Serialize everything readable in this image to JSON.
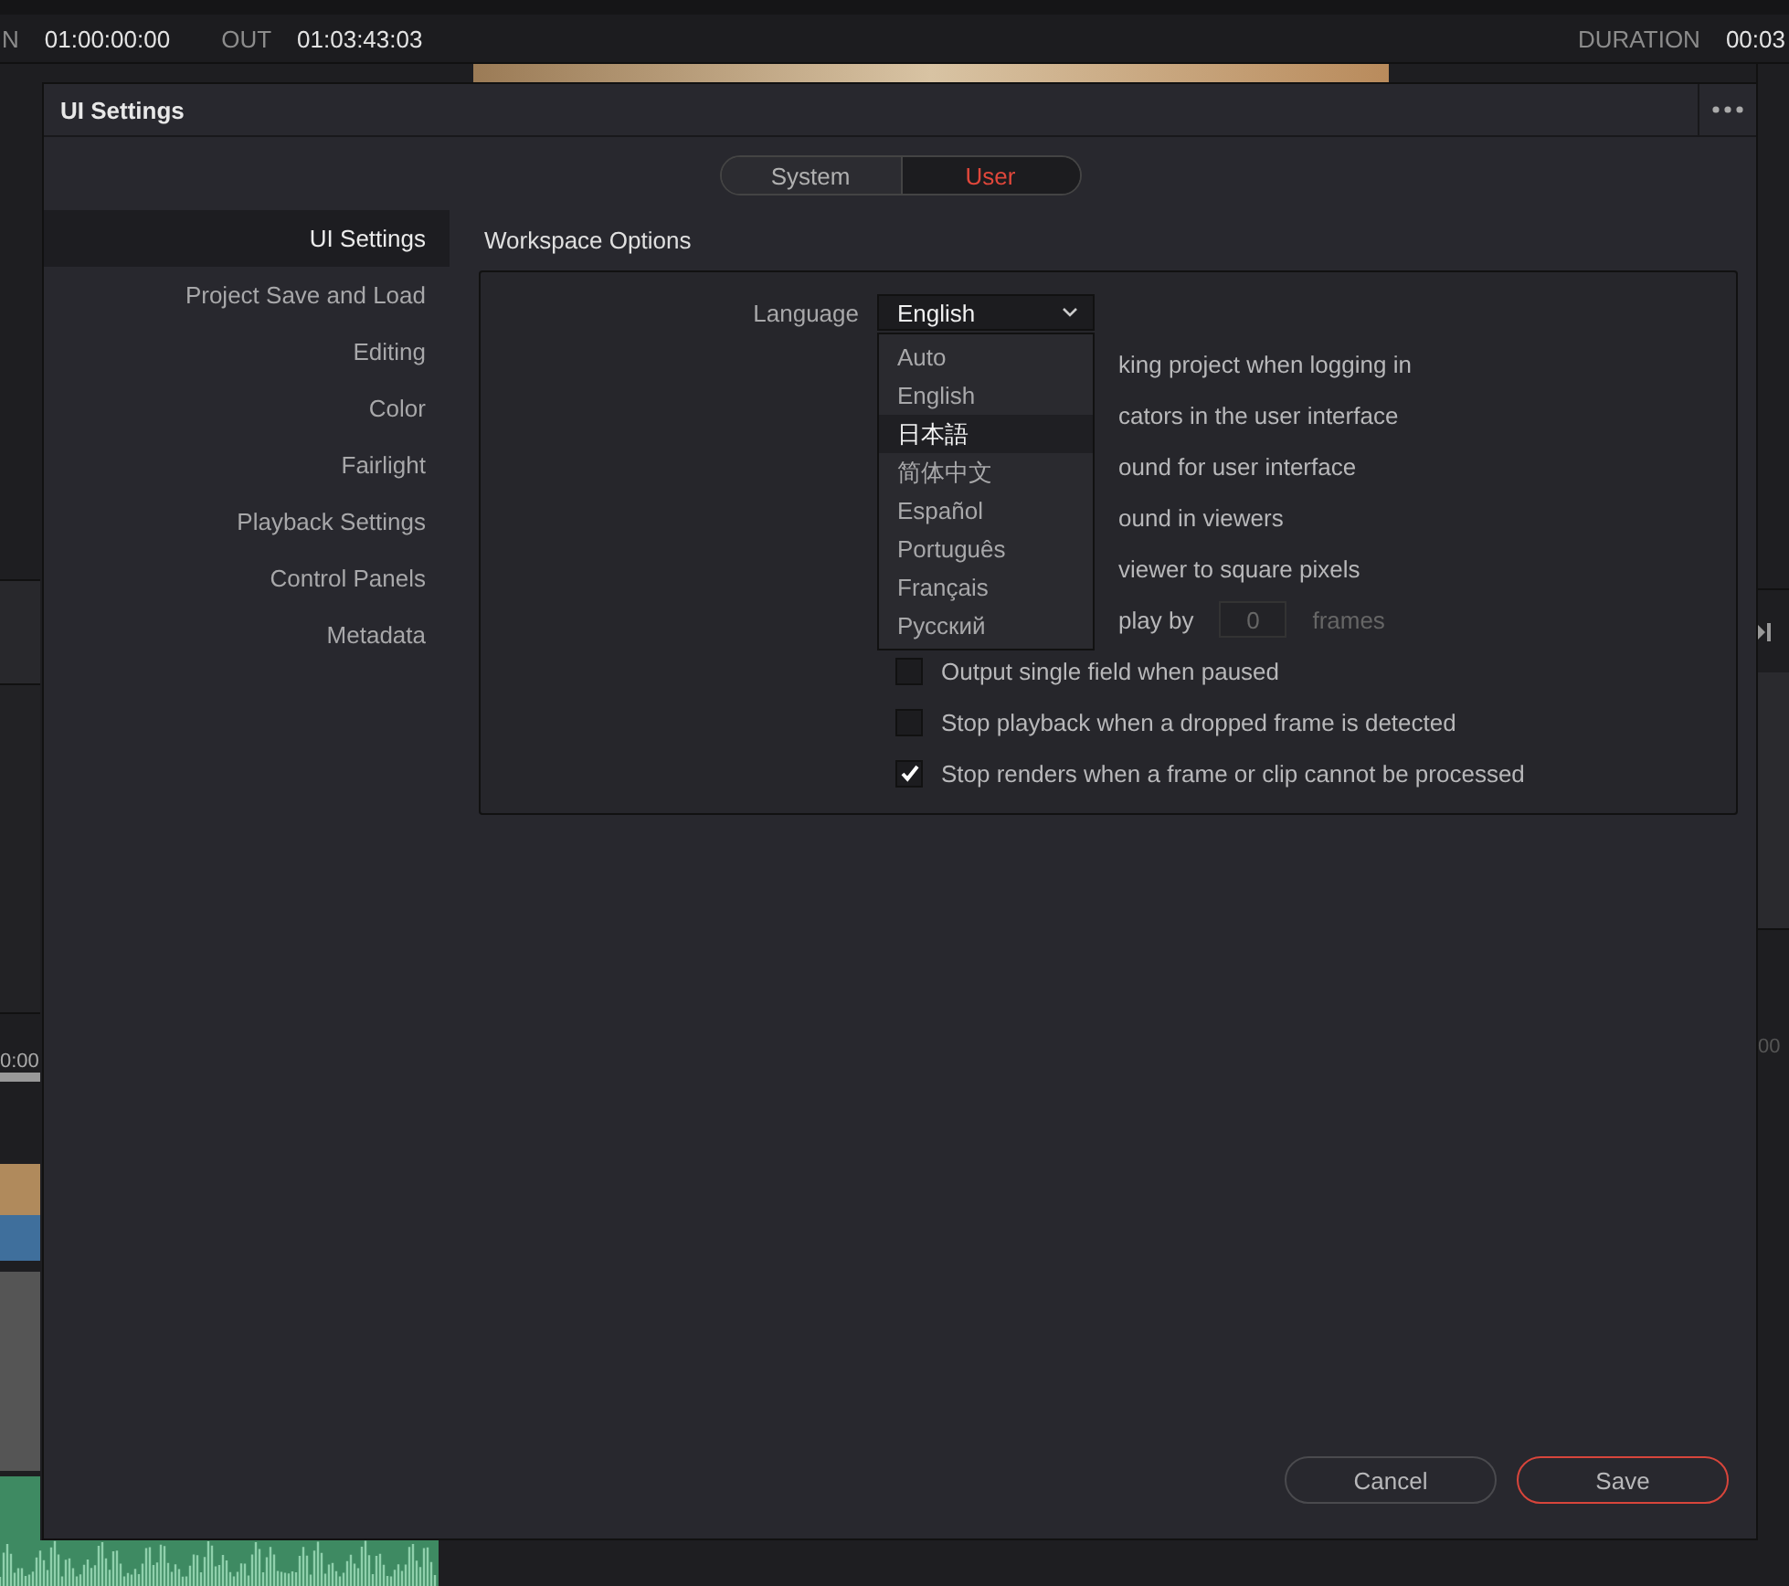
{
  "timecode_bar": {
    "in_label": "N",
    "in_value": "01:00:00:00",
    "out_label": "OUT",
    "out_value": "01:03:43:03",
    "duration_label": "DURATION",
    "duration_value": "00:03"
  },
  "timeline": {
    "left_time": "0:00",
    "right_time": "00"
  },
  "dialog": {
    "title": "UI Settings",
    "tabs": [
      {
        "label": "System",
        "selected": false
      },
      {
        "label": "User",
        "selected": true
      }
    ],
    "sidebar": {
      "items": [
        {
          "label": "UI Settings",
          "selected": true
        },
        {
          "label": "Project Save and Load",
          "selected": false
        },
        {
          "label": "Editing",
          "selected": false
        },
        {
          "label": "Color",
          "selected": false
        },
        {
          "label": "Fairlight",
          "selected": false
        },
        {
          "label": "Playback Settings",
          "selected": false
        },
        {
          "label": "Control Panels",
          "selected": false
        },
        {
          "label": "Metadata",
          "selected": false
        }
      ]
    },
    "section_title": "Workspace Options",
    "language": {
      "label": "Language",
      "value": "English",
      "options": [
        {
          "label": "Auto",
          "highlighted": false
        },
        {
          "label": "English",
          "highlighted": false
        },
        {
          "label": "日本語",
          "highlighted": true
        },
        {
          "label": "简体中文",
          "highlighted": false
        },
        {
          "label": "Español",
          "highlighted": false
        },
        {
          "label": "Português",
          "highlighted": false
        },
        {
          "label": "Français",
          "highlighted": false
        },
        {
          "label": "Русский",
          "highlighted": false
        }
      ]
    },
    "options": [
      {
        "kind": "covered",
        "text": "king project when logging in"
      },
      {
        "kind": "covered",
        "text": "cators in the user interface"
      },
      {
        "kind": "covered",
        "text": "ound for user interface"
      },
      {
        "kind": "covered",
        "text": "ound in viewers"
      },
      {
        "kind": "covered",
        "text": "viewer to square pixels"
      },
      {
        "kind": "covered-delay",
        "text": "play by",
        "value": "0",
        "unit": "frames"
      },
      {
        "kind": "checkbox",
        "text": "Output single field when paused",
        "checked": false
      },
      {
        "kind": "checkbox",
        "text": "Stop playback when a dropped frame is detected",
        "checked": false
      },
      {
        "kind": "checkbox",
        "text": "Stop renders when a frame or clip cannot be processed",
        "checked": true
      }
    ],
    "buttons": [
      {
        "label": "Cancel",
        "kind": "secondary"
      },
      {
        "label": "Save",
        "kind": "primary"
      }
    ]
  }
}
